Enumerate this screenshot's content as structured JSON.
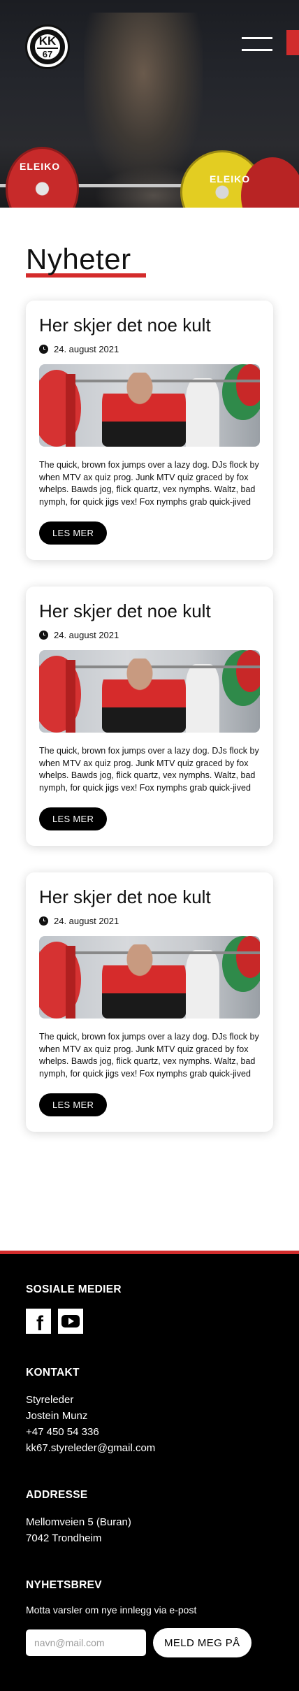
{
  "header": {
    "logo": {
      "top_text": "STYRELEKEN",
      "main": "KK",
      "number": "67",
      "bottom_text": "KRAFTSPORTKLUBB"
    },
    "hero_plate_labels": [
      "ELEIKO",
      "ELEIKO"
    ],
    "menu_icon": "hamburger-icon"
  },
  "news": {
    "title": "Nyheter",
    "accent_color": "#d42b2b",
    "articles": [
      {
        "title": "Her skjer det noe kult",
        "date": "24. august 2021",
        "image_icon": "powerlifter-photo",
        "excerpt": "The quick, brown fox jumps over a lazy dog. DJs flock by when MTV ax quiz prog. Junk MTV quiz graced by fox whelps. Bawds jog, flick quartz, vex nymphs. Waltz, bad nymph, for quick jigs vex! Fox nymphs grab quick-jived",
        "button": "LES MER"
      },
      {
        "title": "Her skjer det noe kult",
        "date": "24. august 2021",
        "image_icon": "powerlifter-photo",
        "excerpt": "The quick, brown fox jumps over a lazy dog. DJs flock by when MTV ax quiz prog. Junk MTV quiz graced by fox whelps. Bawds jog, flick quartz, vex nymphs. Waltz, bad nymph, for quick jigs vex! Fox nymphs grab quick-jived",
        "button": "LES MER"
      },
      {
        "title": "Her skjer det noe kult",
        "date": "24. august 2021",
        "image_icon": "powerlifter-photo",
        "excerpt": "The quick, brown fox jumps over a lazy dog. DJs flock by when MTV ax quiz prog. Junk MTV quiz graced by fox whelps. Bawds jog, flick quartz, vex nymphs. Waltz, bad nymph, for quick jigs vex! Fox nymphs grab quick-jived",
        "button": "LES MER"
      }
    ]
  },
  "footer": {
    "accent_color": "#d12c2c",
    "social": {
      "heading": "SOSIALE MEDIER",
      "icons": [
        "facebook-icon",
        "youtube-icon"
      ]
    },
    "contact": {
      "heading": "KONTAKT",
      "lines": [
        "Styreleder",
        "Jostein Munz",
        "+47 450 54 336",
        "kk67.styreleder@gmail.com"
      ]
    },
    "address": {
      "heading": "ADDRESSE",
      "lines": [
        "Mellomveien 5 (Buran)",
        "7042 Trondheim"
      ]
    },
    "newsletter": {
      "heading": "NYHETSBREV",
      "text": "Motta varsler om nye innlegg via e-post",
      "placeholder": "navn@mail.com",
      "button": "MELD MEG PÅ"
    }
  }
}
